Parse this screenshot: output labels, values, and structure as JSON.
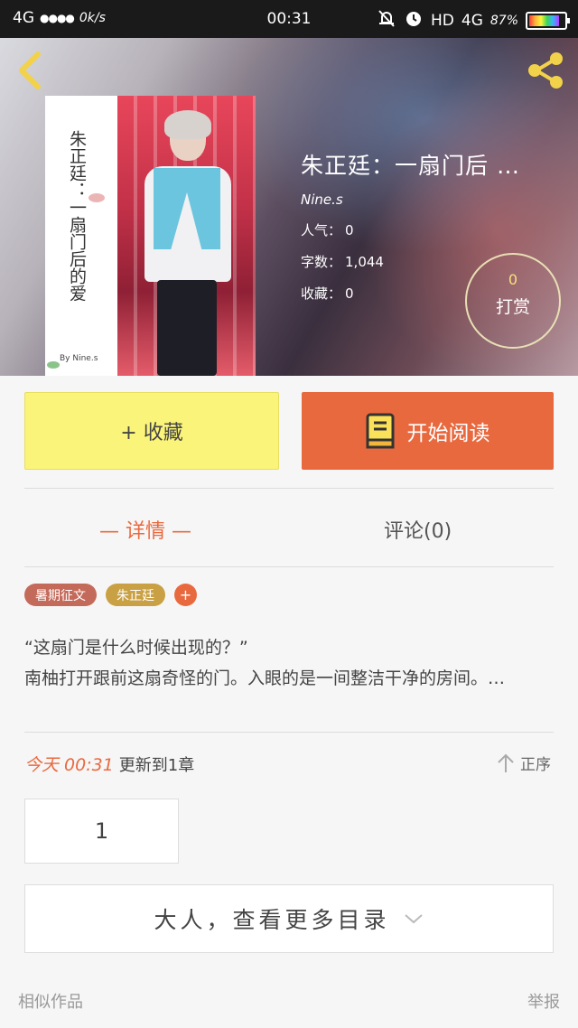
{
  "status_bar": {
    "network": "4G",
    "signal": "●●●●",
    "speed": "0k/s",
    "time": "00:31",
    "hd": "HD",
    "network_right": "4G",
    "battery": "87%"
  },
  "book": {
    "cover_title": "朱正廷：一扇门后的爱",
    "cover_author": "By Nine.s",
    "title": "朱正廷：一扇门后 …",
    "author": "Nine.s",
    "popularity_label": "人气：",
    "popularity": "0",
    "word_count_label": "字数：",
    "word_count": "1,044",
    "favorites_label": "收藏：",
    "favorites": "0"
  },
  "tip": {
    "count": "0",
    "label": "打赏"
  },
  "actions": {
    "collect_label": "+ 收藏",
    "read_label": "开始阅读"
  },
  "tabs": {
    "detail": "— 详情 —",
    "comments": "评论(0)"
  },
  "tags": [
    "暑期征文",
    "朱正廷"
  ],
  "tag_add": "+",
  "description": {
    "line1": "“这扇门是什么时候出现的？”",
    "line2": "南柚打开跟前这扇奇怪的门。入眼的是一间整洁干净的房间。…"
  },
  "update": {
    "time": "今天 00:31",
    "text": "更新到1章"
  },
  "sort_label": "正序",
  "chapters": [
    "1"
  ],
  "more_catalog": "大人，查看更多目录",
  "footer": {
    "similar": "相似作品",
    "report": "举报"
  },
  "colors": {
    "accent": "#e9693f",
    "collect_bg": "#fbf47a",
    "back_icon": "#f2d24a"
  }
}
